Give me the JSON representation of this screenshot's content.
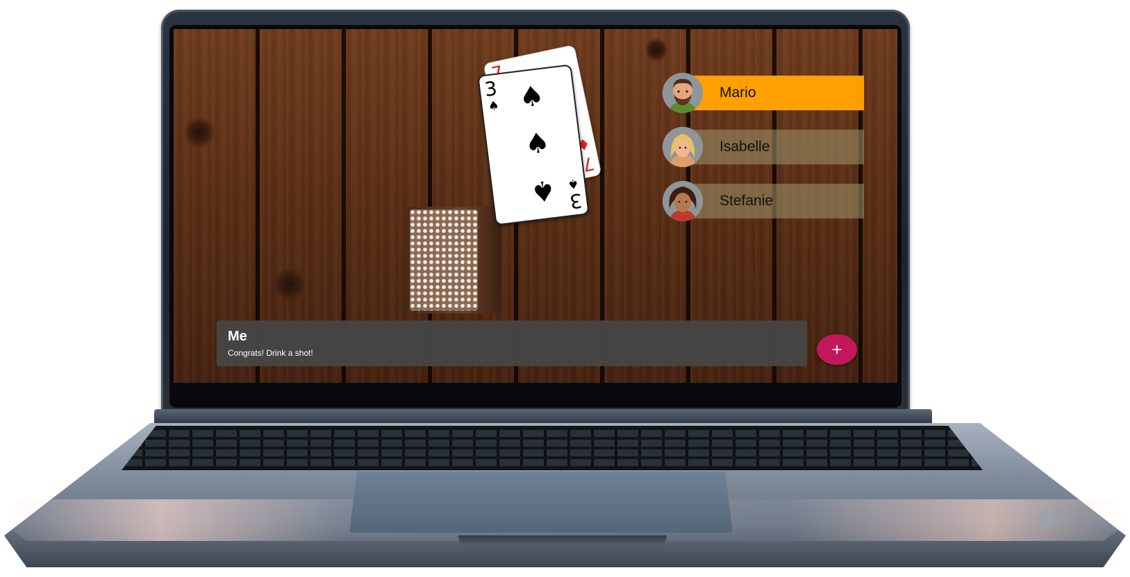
{
  "game": {
    "played_cards": [
      {
        "rank": "7",
        "suit": "diamonds",
        "suit_symbol": "♦",
        "color": "#e0201b"
      },
      {
        "rank": "3",
        "suit": "spades",
        "suit_symbol": "♠",
        "color": "#000000"
      }
    ],
    "deck": {
      "label": "draw-pile"
    }
  },
  "players": [
    {
      "name": "Mario",
      "active": true,
      "bar_color": "#ffa000",
      "avatar_icon": "man-beard-avatar-icon"
    },
    {
      "name": "Isabelle",
      "active": false,
      "bar_color": "rgba(160,150,110,0.55)",
      "avatar_icon": "woman-blonde-avatar-icon"
    },
    {
      "name": "Stefanie",
      "active": false,
      "bar_color": "rgba(160,150,110,0.55)",
      "avatar_icon": "woman-curly-avatar-icon"
    }
  ],
  "message": {
    "sender": "Me",
    "text": "Congrats! Drink a shot!"
  },
  "fab": {
    "label": "+",
    "icon": "plus-icon",
    "color": "#c2185b"
  }
}
